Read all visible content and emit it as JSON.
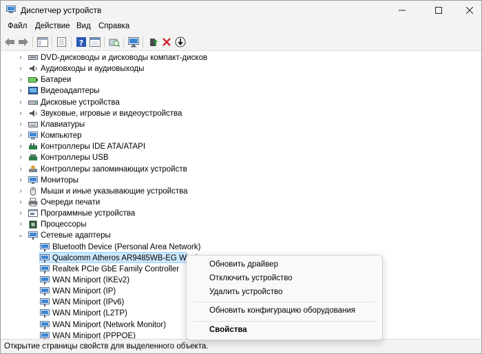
{
  "window": {
    "title": "Диспетчер устройств"
  },
  "menu": [
    "Файл",
    "Действие",
    "Вид",
    "Справка"
  ],
  "tree": {
    "categories": [
      {
        "label": "DVD-дисководы и дисководы компакт-дисков",
        "icon": "dvd-drive-icon"
      },
      {
        "label": "Аудиовходы и аудиовыходы",
        "icon": "speaker-icon"
      },
      {
        "label": "Батареи",
        "icon": "battery-icon"
      },
      {
        "label": "Видеоадаптеры",
        "icon": "display-adapter-icon"
      },
      {
        "label": "Дисковые устройства",
        "icon": "disk-drive-icon"
      },
      {
        "label": "Звуковые, игровые и видеоустройства",
        "icon": "speaker-icon"
      },
      {
        "label": "Клавиатуры",
        "icon": "keyboard-icon"
      },
      {
        "label": "Компьютер",
        "icon": "computer-icon"
      },
      {
        "label": "Контроллеры IDE ATA/ATAPI",
        "icon": "ide-controller-icon"
      },
      {
        "label": "Контроллеры USB",
        "icon": "usb-controller-icon"
      },
      {
        "label": "Контроллеры запоминающих устройств",
        "icon": "storage-controller-icon"
      },
      {
        "label": "Мониторы",
        "icon": "monitor-icon"
      },
      {
        "label": "Мыши и иные указывающие устройства",
        "icon": "mouse-icon"
      },
      {
        "label": "Очереди печати",
        "icon": "printer-icon"
      },
      {
        "label": "Программные устройства",
        "icon": "software-device-icon"
      },
      {
        "label": "Процессоры",
        "icon": "processor-icon"
      },
      {
        "label": "Сетевые адаптеры",
        "icon": "network-adapter-icon"
      }
    ],
    "network_children": [
      "Bluetooth Device (Personal Area Network)",
      "Qualcomm Atheros AR9485WB-EG Wireless Network Adapter",
      "Realtek PCIe GbE Family Controller",
      "WAN Miniport (IKEv2)",
      "WAN Miniport (IP)",
      "WAN Miniport (IPv6)",
      "WAN Miniport (L2TP)",
      "WAN Miniport (Network Monitor)",
      "WAN Miniport (PPPOE)"
    ],
    "selected_label": "Qualcomm Atheros AR9485WB-EG Wirele"
  },
  "context_menu": {
    "update_driver": "Обновить драйвер",
    "disable_device": "Отключить устройство",
    "uninstall_device": "Удалить устройство",
    "scan_hardware": "Обновить конфигурацию оборудования",
    "properties": "Свойства"
  },
  "status": "Открытие страницы свойств для выделенного объекта.",
  "colors": {
    "selection": "#cce8ff",
    "accent": "#0067c0",
    "delete_red": "#d1242f",
    "enable_green": "#2e9b3a"
  }
}
